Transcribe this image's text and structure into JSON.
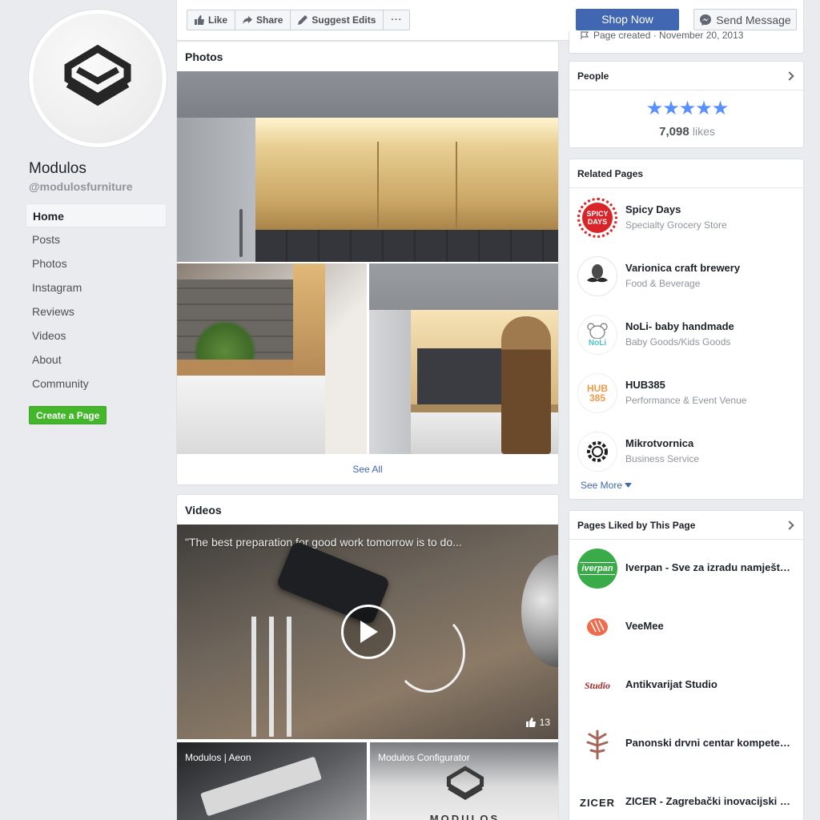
{
  "page": {
    "name": "Modulos",
    "handle": "@modulosfurniture"
  },
  "nav": {
    "items": [
      {
        "label": "Home"
      },
      {
        "label": "Posts"
      },
      {
        "label": "Photos"
      },
      {
        "label": "Instagram"
      },
      {
        "label": "Reviews"
      },
      {
        "label": "Videos"
      },
      {
        "label": "About"
      },
      {
        "label": "Community"
      }
    ],
    "active": "Home",
    "create_page_label": "Create a Page"
  },
  "actions": {
    "like_label": "Like",
    "share_label": "Share",
    "suggest_label": "Suggest Edits",
    "more_label": "···",
    "shop_label": "Shop Now",
    "message_label": "Send Message"
  },
  "partial_text": "Page created · November 20, 2013",
  "photos": {
    "title": "Photos",
    "see_all_label": "See All"
  },
  "videos": {
    "title": "Videos",
    "main_caption": "\"The best preparation for good work tomorrow is to do...",
    "main_likes": "13",
    "thumbs": [
      {
        "caption": "Modulos | Aeon"
      },
      {
        "caption": "Modulos Configurator"
      }
    ],
    "brand_watermark": "MODULOS"
  },
  "people": {
    "title": "People",
    "likes_count": "7,098",
    "likes_label": "likes",
    "stars": "★★★★★"
  },
  "related": {
    "title": "Related Pages",
    "see_more_label": "See More",
    "items": [
      {
        "name": "Spicy Days",
        "category": "Specialty Grocery Store",
        "logo_text": "SPICY DAYS"
      },
      {
        "name": "Varionica craft brewery",
        "category": "Food & Beverage"
      },
      {
        "name": "NoLi- baby handmade",
        "category": "Baby Goods/Kids Goods",
        "logo_text": "NoLi"
      },
      {
        "name": "HUB385",
        "category": "Performance & Event Venue",
        "logo_text": "HUB 385"
      },
      {
        "name": "Mikrotvornica",
        "category": "Business Service"
      }
    ]
  },
  "liked": {
    "title": "Pages Liked by This Page",
    "items": [
      {
        "name": "Iverpan - Sve za izradu namještaja",
        "logo_text": "iverpan"
      },
      {
        "name": "VeeMee"
      },
      {
        "name": "Antikvarijat Studio",
        "logo_text": "Studio"
      },
      {
        "name": "Panonski drvni centar kompetencija"
      },
      {
        "name": "ZICER - Zagrebački inovacijski centar",
        "logo_text": "ZICER"
      }
    ]
  },
  "colors": {
    "accent": "#4267b2",
    "green": "#42b72a",
    "star": "#5890ff",
    "bg": "#e9ebee"
  }
}
